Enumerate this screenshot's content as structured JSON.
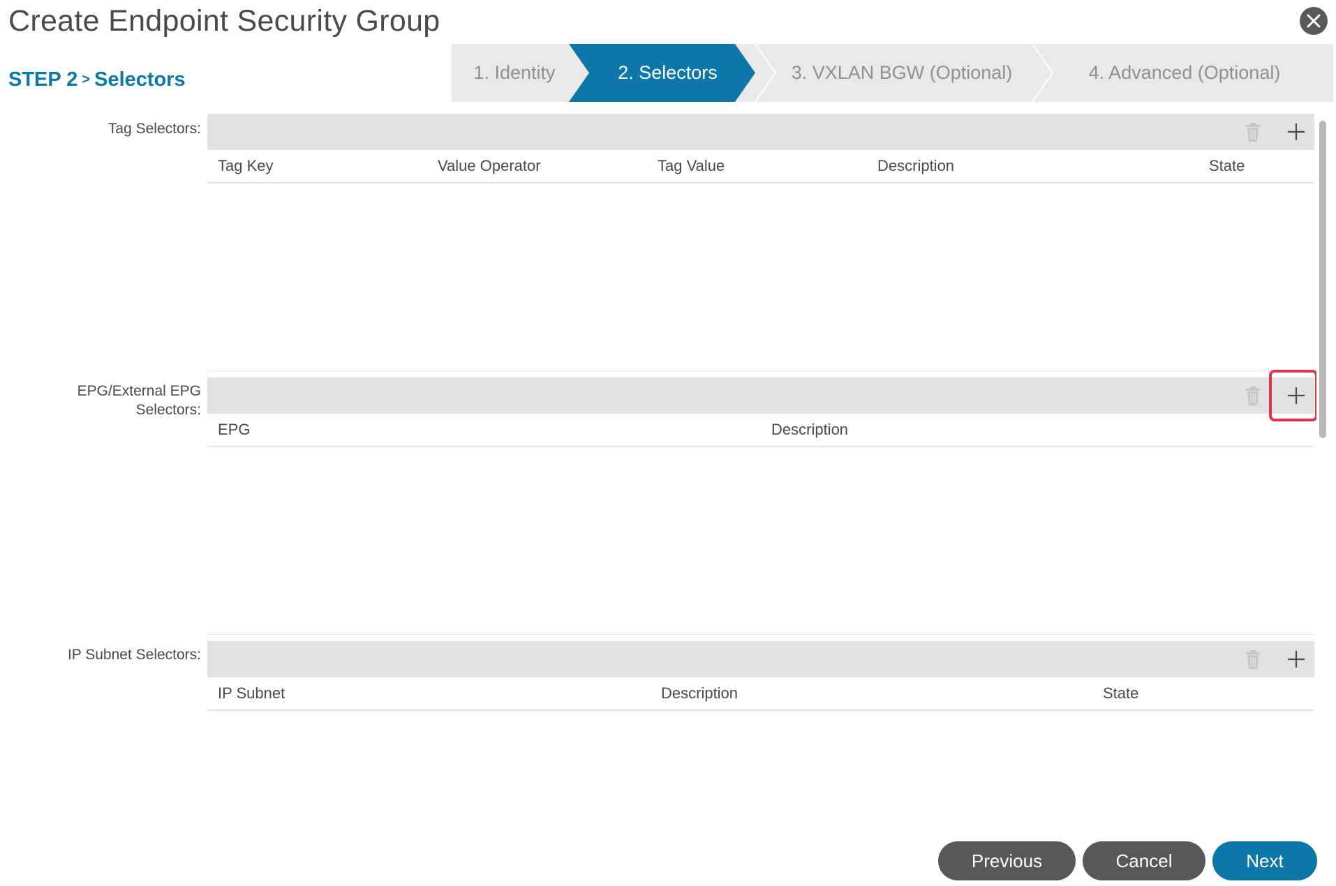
{
  "dialog": {
    "title": "Create Endpoint Security Group",
    "close_icon": "close-icon",
    "step_prefix": "STEP 2",
    "step_separator": ">",
    "step_name": "Selectors"
  },
  "wizard": {
    "active_color": "#0d77a8",
    "steps": [
      {
        "label": "1. Identity",
        "active": false
      },
      {
        "label": "2. Selectors",
        "active": true
      },
      {
        "label": "3. VXLAN BGW (Optional)",
        "active": false
      },
      {
        "label": "4. Advanced (Optional)",
        "active": false
      }
    ]
  },
  "sections": {
    "tag": {
      "label": "Tag Selectors:",
      "columns": [
        "Tag Key",
        "Value Operator",
        "Tag Value",
        "Description",
        "State"
      ],
      "rows": []
    },
    "epg": {
      "label_line1": "EPG/External EPG",
      "label_line2": "Selectors:",
      "columns": [
        "EPG",
        "Description"
      ],
      "rows": []
    },
    "ip": {
      "label": "IP Subnet Selectors:",
      "columns": [
        "IP Subnet",
        "Description",
        "State"
      ],
      "rows": []
    }
  },
  "icons": {
    "delete": "trash-icon",
    "add": "plus-icon"
  },
  "footer": {
    "previous": "Previous",
    "cancel": "Cancel",
    "next": "Next"
  },
  "colors": {
    "accent": "#0d77a8",
    "highlight": "#d9384a",
    "secondary_button": "#58585a"
  }
}
